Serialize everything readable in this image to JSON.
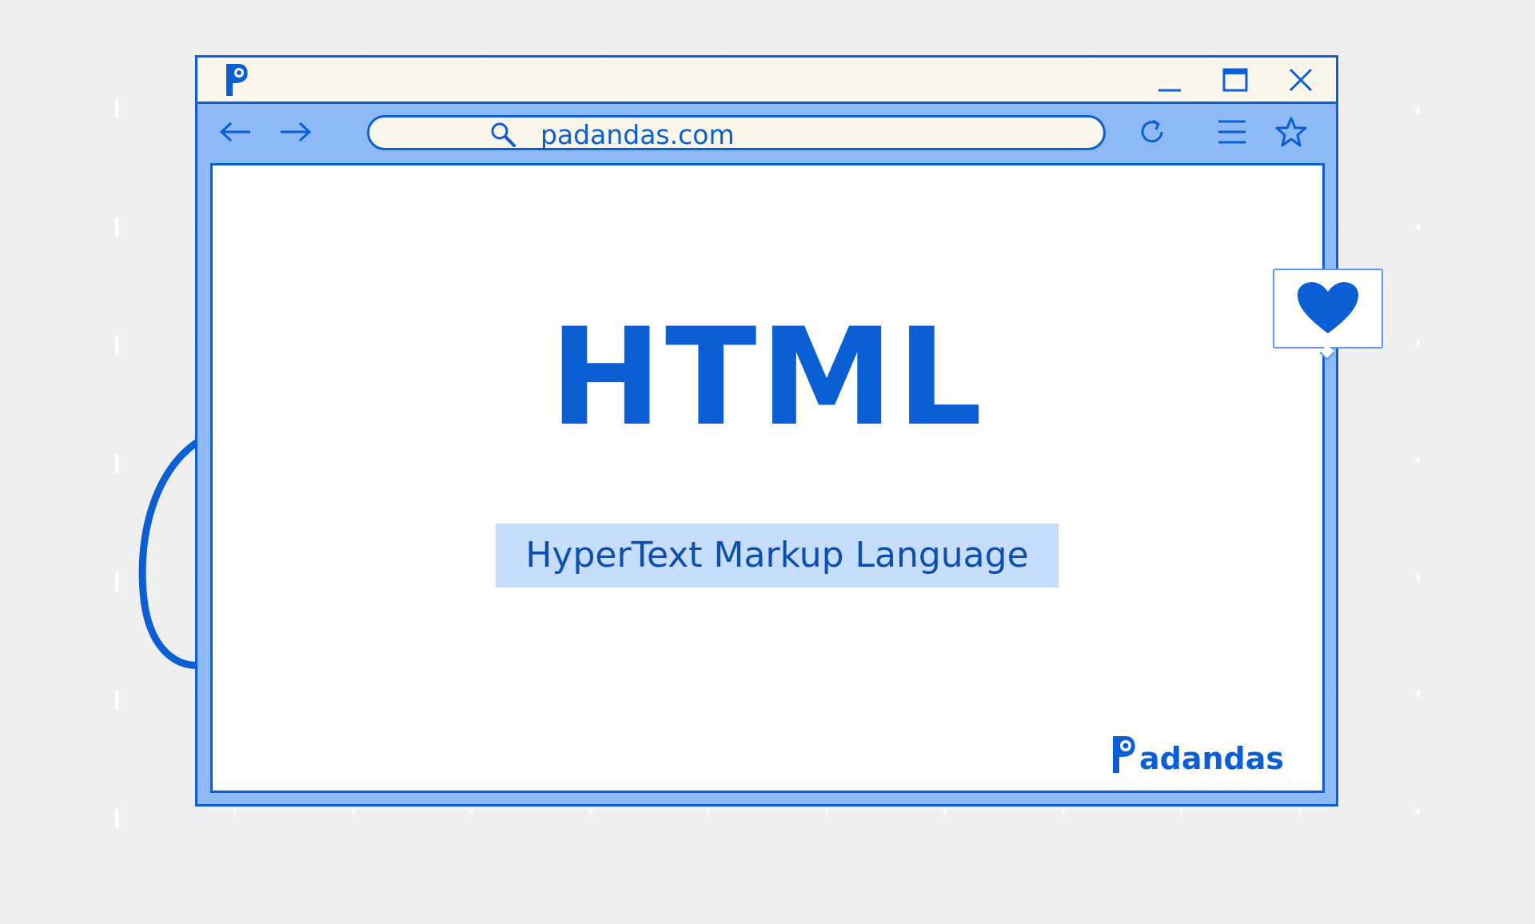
{
  "titlebar": {
    "logo_letter": "P",
    "controls": [
      "minimize-icon",
      "maximize-icon",
      "close-icon"
    ]
  },
  "toolbar": {
    "back_icon": "arrow-left-icon",
    "forward_icon": "arrow-right-icon",
    "url": "padandas.com",
    "search_icon": "search-icon",
    "reload_icon": "reload-icon",
    "menu_icon": "menu-icon",
    "bookmark_icon": "star-icon"
  },
  "main": {
    "headline": "HTML",
    "subtitle": "HyperText Markup Language",
    "brand": "adandas",
    "brand_letter": "P"
  },
  "reaction": {
    "icon": "heart-icon"
  },
  "colors": {
    "accent": "#0b5fd4",
    "toolbar": "#8db9f7",
    "titlebar": "#faf6ec",
    "highlight": "#c6ddfb",
    "grid": "#efefef"
  }
}
